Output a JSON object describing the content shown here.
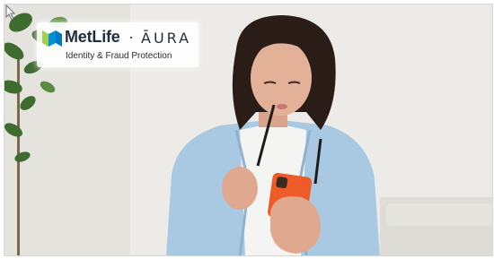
{
  "brand": {
    "primary": "MetLife",
    "separator": "·",
    "partner": "ĀURA",
    "tagline": "Identity & Fraud Protection"
  },
  "icons": {
    "cursor": "cursor-icon",
    "logo": "metlife-logo-icon"
  },
  "colors": {
    "background": "#ecebe7",
    "shirt": "#a9c8e2",
    "phone": "#ef5a29",
    "logo_blue": "#0090da",
    "logo_green": "#a4ce4e",
    "brand_text": "#1f2d3d"
  }
}
